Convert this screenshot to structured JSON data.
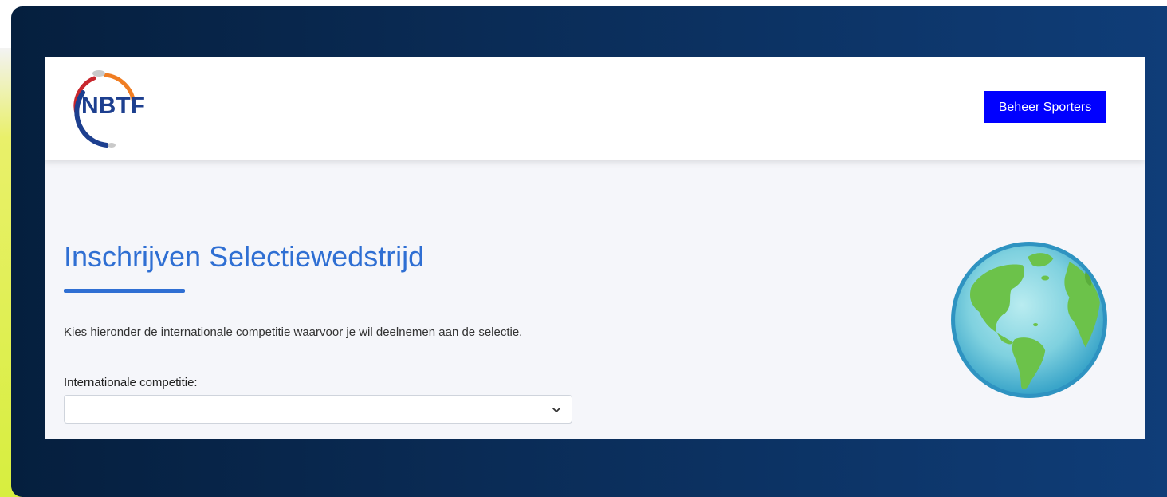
{
  "header": {
    "logo_text": "NBTF",
    "manage_button_label": "Beheer Sporters"
  },
  "main": {
    "title": "Inschrijven Selectiewedstrijd",
    "intro": "Kies hieronder de internationale competitie waarvoor je wil deelnemen aan de selectie.",
    "competition_field": {
      "label": "Internationale competitie:",
      "value": ""
    }
  },
  "icons": {
    "logo": "nbtf-logo",
    "select_arrow": "chevron-down-icon",
    "illustration": "globe-icon"
  },
  "colors": {
    "accent": "#2f6fd3",
    "button": "#0000ff",
    "page_bg": "#f5f6fa",
    "frame_bg": "#0a2b55"
  }
}
